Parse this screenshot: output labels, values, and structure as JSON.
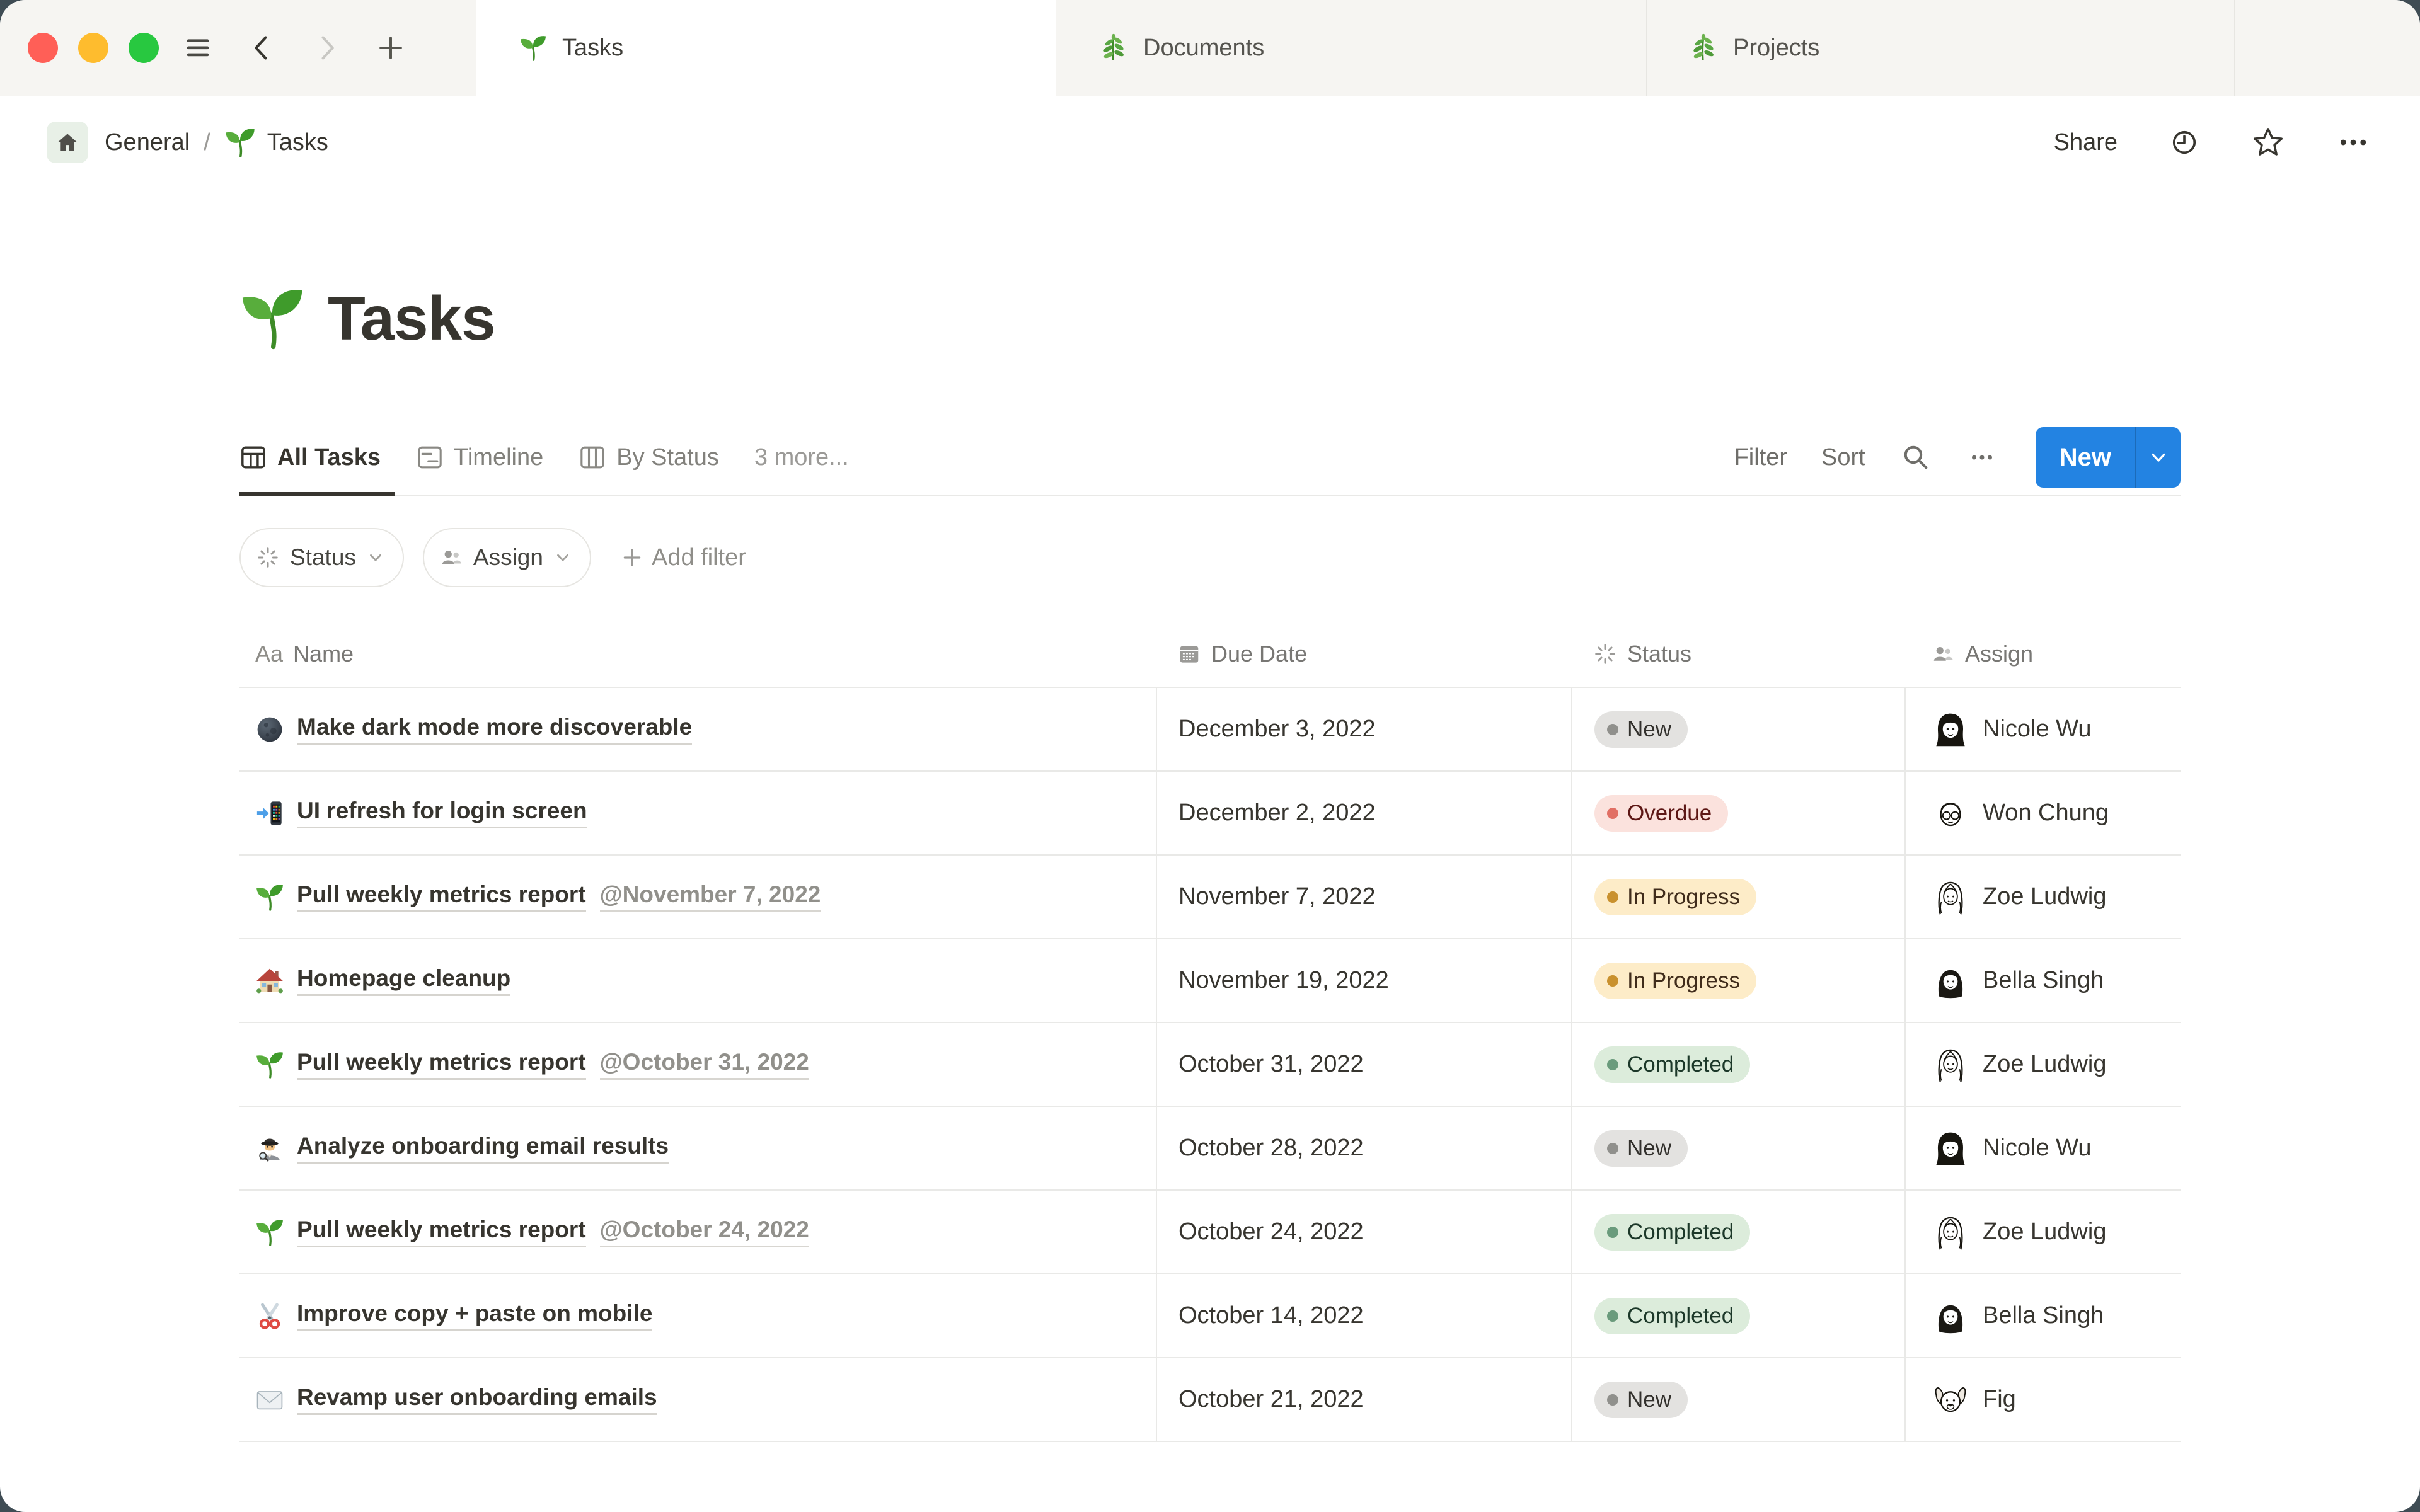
{
  "chrome": {
    "tabs": [
      {
        "label": "Tasks"
      },
      {
        "label": "Documents"
      },
      {
        "label": "Projects"
      }
    ]
  },
  "breadcrumb": {
    "root": "General",
    "separator": "/",
    "current": "Tasks",
    "share_label": "Share"
  },
  "page": {
    "title": "Tasks"
  },
  "toolbar": {
    "view_tabs": [
      {
        "label": "All Tasks"
      },
      {
        "label": "Timeline"
      },
      {
        "label": "By Status"
      }
    ],
    "more_label": "3 more...",
    "filter_label": "Filter",
    "sort_label": "Sort",
    "new_label": "New"
  },
  "filter_bar": {
    "chips": [
      {
        "label": "Status"
      },
      {
        "label": "Assign"
      }
    ],
    "add_filter_label": "Add filter"
  },
  "table": {
    "columns": [
      {
        "label": "Name",
        "type_glyph": "Aa"
      },
      {
        "label": "Due Date"
      },
      {
        "label": "Status"
      },
      {
        "label": "Assign"
      }
    ],
    "rows": [
      {
        "icon": "new-moon-emoji",
        "name": "Make dark mode more discoverable",
        "due": "December 3, 2022",
        "status": "New",
        "assignee": "Nicole Wu"
      },
      {
        "icon": "mobile-phone-arrow-emoji",
        "name": "UI refresh for login screen",
        "due": "December 2, 2022",
        "status": "Overdue",
        "assignee": "Won Chung"
      },
      {
        "icon": "seedling-emoji",
        "name": "Pull weekly metrics report",
        "mention": "@November 7, 2022",
        "due": "November 7, 2022",
        "status": "In Progress",
        "assignee": "Zoe Ludwig"
      },
      {
        "icon": "house-emoji",
        "name": "Homepage cleanup",
        "due": "November 19, 2022",
        "status": "In Progress",
        "assignee": "Bella Singh"
      },
      {
        "icon": "seedling-emoji",
        "name": "Pull weekly metrics report",
        "mention": "@October 31, 2022",
        "due": "October 31, 2022",
        "status": "Completed",
        "assignee": "Zoe Ludwig"
      },
      {
        "icon": "detective-emoji",
        "name": "Analyze onboarding email results",
        "due": "October 28, 2022",
        "status": "New",
        "assignee": "Nicole Wu"
      },
      {
        "icon": "seedling-emoji",
        "name": "Pull weekly metrics report",
        "mention": "@October 24, 2022",
        "due": "October 24, 2022",
        "status": "Completed",
        "assignee": "Zoe Ludwig"
      },
      {
        "icon": "scissors-emoji",
        "name": "Improve copy + paste on mobile",
        "due": "October 14, 2022",
        "status": "Completed",
        "assignee": "Bella Singh"
      },
      {
        "icon": "envelope-emoji",
        "name": "Revamp user onboarding emails",
        "due": "October 21, 2022",
        "status": "New",
        "assignee": "Fig"
      }
    ]
  },
  "colors": {
    "accent_blue": "#2383e2",
    "tag_gray_bg": "#e3e2e0",
    "tag_red_bg": "#fbe2dd",
    "tag_yellow_bg": "#fdecc8",
    "tag_green_bg": "#dcecdb",
    "tag_red_text": "#5d1715",
    "tag_yellow_text": "#402c1b",
    "tag_green_text": "#1c3829",
    "tag_gray_text": "#32302c"
  }
}
